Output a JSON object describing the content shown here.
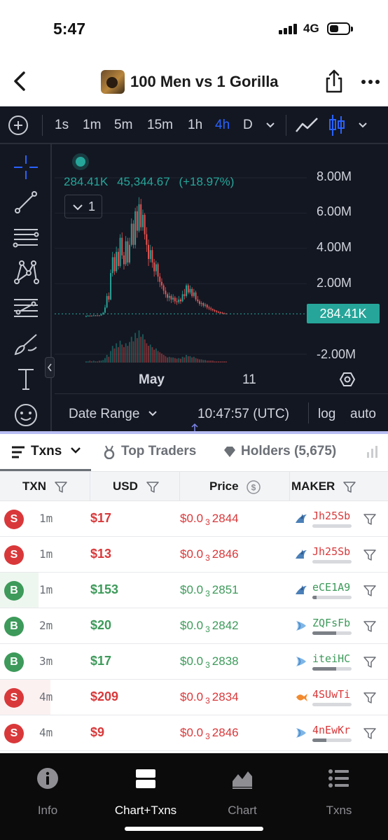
{
  "status_bar": {
    "time": "5:47",
    "network": "4G"
  },
  "header": {
    "title": "100 Men vs 1 Gorilla"
  },
  "chart_toolbar": {
    "intervals": [
      "1s",
      "1m",
      "5m",
      "15m",
      "1h",
      "4h",
      "D"
    ],
    "active_interval": "4h"
  },
  "chart": {
    "legend": {
      "price": "284.41K",
      "change_value": "45,344.67",
      "change_pct": "(+18.97%)",
      "indicator_count": "1"
    },
    "y_ticks": [
      "8.00M",
      "6.00M",
      "4.00M",
      "2.00M",
      "-2.00M"
    ],
    "x_ticks": [
      "May",
      "11"
    ],
    "last_price_tag": "284.41K",
    "footer": {
      "date_range": "Date Range",
      "utc_time": "10:47:57 (UTC)",
      "log": "log",
      "auto": "auto"
    }
  },
  "chart_data": {
    "type": "candlestick",
    "ylabel": "",
    "ylim": [
      -2000000,
      8000000
    ],
    "yticks": [
      8000000,
      6000000,
      4000000,
      2000000,
      -2000000
    ],
    "x_tick_labels": [
      "May",
      "11"
    ],
    "last_price": 284410,
    "colors": {
      "up": "#26a69a",
      "down": "#ef5350"
    },
    "candles": [
      [
        0.15,
        0.16,
        0.2,
        0.1
      ],
      [
        0.16,
        0.18,
        0.22,
        0.14
      ],
      [
        0.18,
        0.17,
        0.21,
        0.15
      ],
      [
        0.17,
        0.18,
        0.2,
        0.16
      ],
      [
        0.18,
        0.2,
        0.24,
        0.17
      ],
      [
        0.2,
        0.19,
        0.22,
        0.18
      ],
      [
        0.19,
        0.2,
        0.23,
        0.18
      ],
      [
        0.2,
        0.19,
        0.22,
        0.17
      ],
      [
        0.19,
        0.25,
        0.3,
        0.18
      ],
      [
        0.25,
        0.35,
        0.4,
        0.24
      ],
      [
        0.35,
        0.65,
        0.8,
        0.33
      ],
      [
        0.65,
        1.3,
        1.45,
        0.6
      ],
      [
        1.3,
        1.1,
        1.5,
        0.95
      ],
      [
        1.1,
        2.6,
        2.8,
        1.05
      ],
      [
        2.6,
        3.5,
        3.8,
        2.4
      ],
      [
        3.5,
        2.7,
        3.7,
        2.5
      ],
      [
        2.7,
        3.8,
        4.1,
        2.6
      ],
      [
        3.8,
        3.0,
        4.0,
        2.8
      ],
      [
        3.0,
        4.6,
        4.8,
        2.9
      ],
      [
        4.6,
        3.6,
        4.9,
        3.4
      ],
      [
        3.6,
        3.1,
        3.8,
        2.8
      ],
      [
        3.1,
        4.4,
        4.7,
        3.0
      ],
      [
        4.4,
        3.2,
        4.6,
        3.0
      ],
      [
        3.2,
        4.2,
        4.6,
        3.1
      ],
      [
        4.2,
        5.4,
        5.7,
        4.1
      ],
      [
        5.4,
        4.2,
        5.6,
        4.0
      ],
      [
        4.2,
        6.1,
        6.3,
        4.0
      ],
      [
        6.1,
        5.0,
        6.4,
        4.6
      ],
      [
        5.0,
        6.5,
        6.9,
        4.9
      ],
      [
        6.5,
        5.2,
        6.8,
        5.0
      ],
      [
        5.2,
        5.9,
        6.2,
        5.0
      ],
      [
        5.9,
        4.8,
        6.0,
        4.5
      ],
      [
        4.8,
        4.2,
        5.2,
        3.8
      ],
      [
        4.2,
        3.4,
        4.5,
        3.0
      ],
      [
        3.4,
        3.9,
        4.2,
        3.2
      ],
      [
        3.9,
        3.2,
        4.1,
        2.9
      ],
      [
        3.2,
        2.7,
        3.4,
        2.4
      ],
      [
        2.7,
        3.1,
        3.3,
        2.5
      ],
      [
        3.1,
        2.4,
        3.2,
        2.1
      ],
      [
        2.4,
        2.1,
        2.6,
        1.8
      ],
      [
        2.1,
        1.9,
        2.3,
        1.7
      ],
      [
        1.9,
        1.6,
        2.0,
        1.4
      ],
      [
        1.6,
        1.4,
        1.8,
        1.2
      ],
      [
        1.4,
        1.2,
        1.5,
        1.0
      ],
      [
        1.2,
        1.3,
        1.5,
        1.0
      ],
      [
        1.3,
        1.1,
        1.4,
        0.9
      ],
      [
        1.1,
        1.2,
        1.4,
        0.95
      ],
      [
        1.2,
        1.0,
        1.3,
        0.85
      ],
      [
        1.0,
        0.95,
        1.2,
        0.8
      ],
      [
        0.95,
        1.1,
        1.3,
        0.85
      ],
      [
        1.1,
        1.0,
        1.2,
        0.85
      ],
      [
        1.0,
        1.4,
        1.6,
        0.95
      ],
      [
        1.4,
        1.3,
        1.7,
        1.1
      ],
      [
        1.3,
        1.9,
        2.0,
        1.2
      ],
      [
        1.9,
        1.5,
        2.0,
        1.4
      ],
      [
        1.5,
        1.7,
        1.9,
        1.4
      ],
      [
        1.7,
        1.3,
        1.8,
        1.2
      ],
      [
        1.3,
        1.5,
        1.7,
        1.2
      ],
      [
        1.5,
        1.1,
        1.6,
        1.0
      ],
      [
        1.1,
        1.0,
        1.3,
        0.9
      ],
      [
        1.0,
        0.85,
        1.1,
        0.75
      ],
      [
        0.85,
        0.9,
        1.0,
        0.7
      ],
      [
        0.9,
        0.75,
        0.95,
        0.65
      ],
      [
        0.75,
        0.8,
        0.9,
        0.65
      ],
      [
        0.8,
        0.65,
        0.85,
        0.55
      ],
      [
        0.65,
        0.6,
        0.75,
        0.5
      ],
      [
        0.6,
        0.55,
        0.7,
        0.45
      ],
      [
        0.55,
        0.5,
        0.6,
        0.42
      ],
      [
        0.5,
        0.45,
        0.55,
        0.38
      ],
      [
        0.45,
        0.4,
        0.5,
        0.34
      ],
      [
        0.4,
        0.38,
        0.45,
        0.32
      ],
      [
        0.38,
        0.35,
        0.42,
        0.3
      ],
      [
        0.35,
        0.32,
        0.4,
        0.28
      ],
      [
        0.32,
        0.3,
        0.36,
        0.27
      ],
      [
        0.3,
        0.29,
        0.33,
        0.27
      ]
    ],
    "volume": [
      2,
      2,
      3,
      2,
      3,
      2,
      2,
      3,
      3,
      4,
      7,
      12,
      9,
      18,
      26,
      22,
      30,
      24,
      34,
      28,
      24,
      30,
      26,
      32,
      40,
      33,
      46,
      38,
      50,
      40,
      44,
      36,
      30,
      26,
      28,
      24,
      20,
      22,
      18,
      16,
      14,
      12,
      10,
      8,
      9,
      8,
      8,
      7,
      6,
      7,
      6,
      9,
      8,
      12,
      10,
      10,
      8,
      9,
      7,
      6,
      5,
      5,
      4,
      4,
      3,
      3,
      3,
      3,
      2,
      2,
      2,
      2,
      2,
      2,
      2
    ]
  },
  "tabs": {
    "txns": "Txns",
    "top_traders": "Top Traders",
    "holders": "Holders (5,675)"
  },
  "table": {
    "columns": [
      "TXN",
      "USD",
      "Price",
      "MAKER"
    ],
    "rows": [
      {
        "type": "S",
        "age": "1m",
        "usd": "$17",
        "price_prefix": "$0.0",
        "price_zeros": "3",
        "price_digits": "2844",
        "maker": "Jh25Sb",
        "maker_icon": "shark-icon",
        "maker_share": 0.0,
        "volume_share": 0.0
      },
      {
        "type": "S",
        "age": "1m",
        "usd": "$13",
        "price_prefix": "$0.0",
        "price_zeros": "3",
        "price_digits": "2846",
        "maker": "Jh25Sb",
        "maker_icon": "shark-icon",
        "maker_share": 0.0,
        "volume_share": 0.0
      },
      {
        "type": "B",
        "age": "1m",
        "usd": "$153",
        "price_prefix": "$0.0",
        "price_zeros": "3",
        "price_digits": "2851",
        "maker": "eCE1A9",
        "maker_icon": "shark-icon",
        "maker_share": 0.1,
        "volume_share": 0.1
      },
      {
        "type": "B",
        "age": "2m",
        "usd": "$20",
        "price_prefix": "$0.0",
        "price_zeros": "3",
        "price_digits": "2842",
        "maker": "ZQFsFb",
        "maker_icon": "shrimp-icon",
        "maker_share": 0.6,
        "volume_share": 0.0
      },
      {
        "type": "B",
        "age": "3m",
        "usd": "$17",
        "price_prefix": "$0.0",
        "price_zeros": "3",
        "price_digits": "2838",
        "maker": "iteiHC",
        "maker_icon": "shrimp-icon",
        "maker_share": 0.6,
        "volume_share": 0.0
      },
      {
        "type": "S",
        "age": "4m",
        "usd": "$209",
        "price_prefix": "$0.0",
        "price_zeros": "3",
        "price_digits": "2834",
        "maker": "4SUwTi",
        "maker_icon": "fish-icon",
        "maker_share": 0.0,
        "volume_share": 0.13
      },
      {
        "type": "S",
        "age": "4m",
        "usd": "$9",
        "price_prefix": "$0.0",
        "price_zeros": "3",
        "price_digits": "2846",
        "maker": "4nEwKr",
        "maker_icon": "shrimp-icon",
        "maker_share": 0.35,
        "volume_share": 0.0
      }
    ]
  },
  "bottom_nav": {
    "items": [
      {
        "label": "Info",
        "icon": "info-icon"
      },
      {
        "label": "Chart+Txns",
        "icon": "split-view-icon"
      },
      {
        "label": "Chart",
        "icon": "area-chart-icon"
      },
      {
        "label": "Txns",
        "icon": "list-icon"
      }
    ],
    "active": "Chart+Txns"
  },
  "colors": {
    "chart_bg": "#131722",
    "up": "#26a69a",
    "down": "#ef5350",
    "sell": "#d9383a",
    "buy": "#3d9a5a",
    "accent": "#2962ff"
  }
}
